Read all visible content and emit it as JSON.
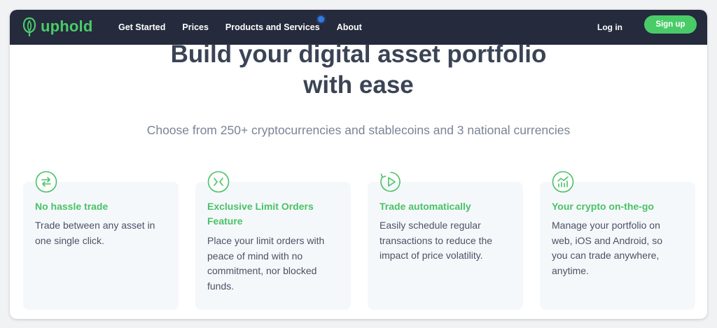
{
  "brand": {
    "name": "uphold",
    "color": "#49cc68",
    "navbar_bg": "#252a3d"
  },
  "nav": {
    "links": [
      {
        "label": "Get Started"
      },
      {
        "label": "Prices"
      },
      {
        "label": "Products and Services",
        "has_notification_dot": true
      },
      {
        "label": "About"
      }
    ],
    "login_label": "Log in",
    "signup_label": "Sign up"
  },
  "hero": {
    "title_line1": "Build your digital asset portfolio",
    "title_line2": "with ease",
    "subtitle": "Choose from 250+ cryptocurrencies and stablecoins and 3 national currencies"
  },
  "features": [
    {
      "icon": "swap-arrows-icon",
      "title": "No hassle trade",
      "description_lines": [
        "Trade between any asset in",
        "one single click."
      ]
    },
    {
      "icon": "limit-orders-icon",
      "title_lines": [
        "Exclusive Limit Orders",
        "Feature"
      ],
      "description_lines": [
        "Place your limit orders with",
        "peace of mind with no",
        "commitment, nor blocked",
        "funds."
      ]
    },
    {
      "icon": "auto-trade-icon",
      "title": "Trade automatically",
      "description_lines": [
        "Easily schedule regular",
        "transactions to reduce the",
        "impact of price volatility."
      ]
    },
    {
      "icon": "mobile-chart-icon",
      "title": "Your crypto on-the-go",
      "description_lines": [
        "Manage your portfolio on",
        "web, iOS and Android, so",
        "you can trade anywhere,",
        "anytime."
      ]
    }
  ]
}
